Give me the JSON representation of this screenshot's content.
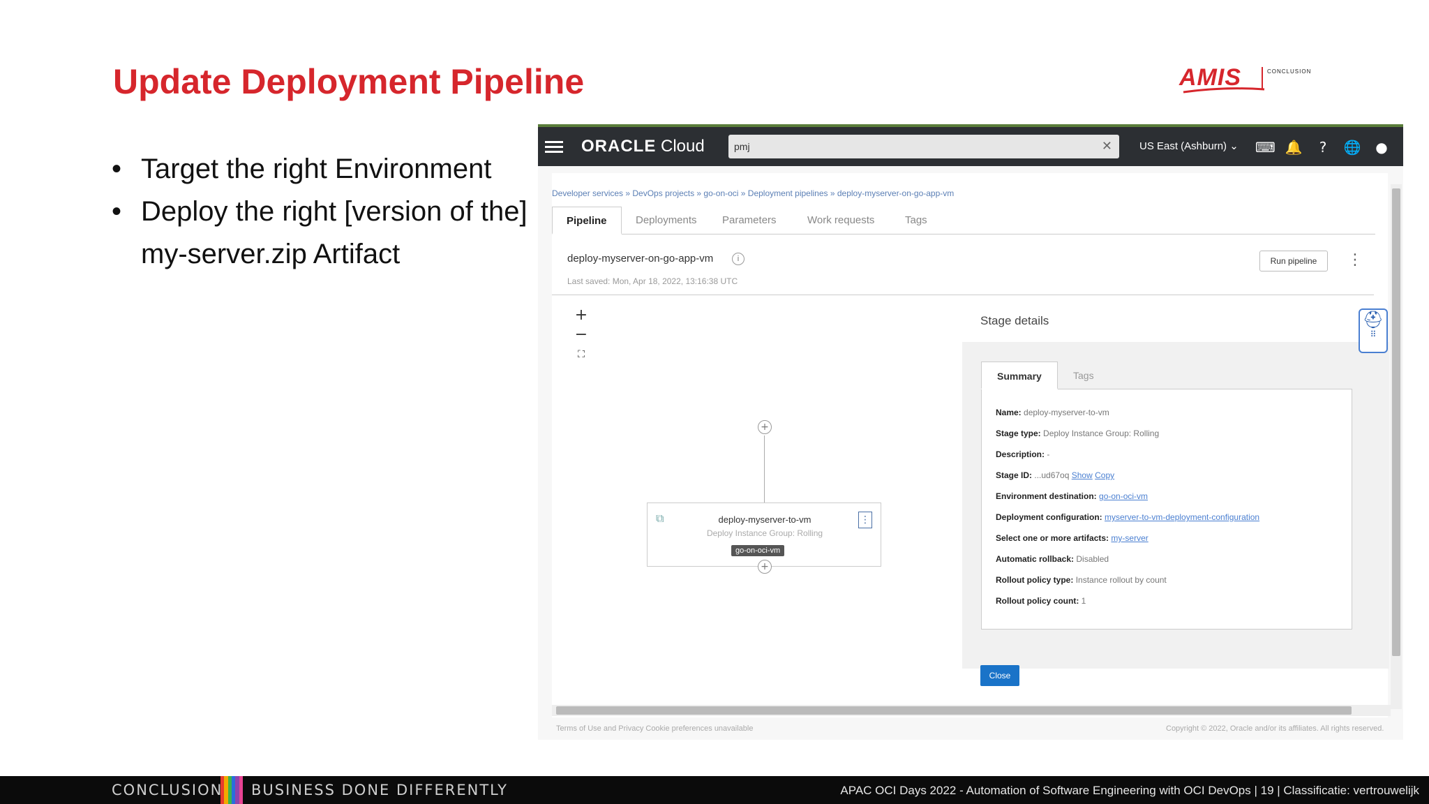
{
  "slide": {
    "title": "Update Deployment Pipeline",
    "bullets": [
      "Target the right Environment",
      "Deploy the right [version of the] my-server.zip Artifact"
    ]
  },
  "logo": {
    "word": "AMIS",
    "sub": "CONCLUSION"
  },
  "oci": {
    "brand_bold": "ORACLE",
    "brand_light": " Cloud",
    "search_value": "pmj",
    "region": "US East (Ashburn) ⌄",
    "breadcrumb": "Developer services » DevOps projects » go-on-oci » Deployment pipelines » deploy-myserver-on-go-app-vm",
    "tabs": [
      "Pipeline",
      "Deployments",
      "Parameters",
      "Work requests",
      "Tags"
    ],
    "pipeline_name": "deploy-myserver-on-go-app-vm",
    "last_saved": "Last saved: Mon, Apr 18, 2022, 13:16:38 UTC",
    "run_pipeline": "Run pipeline",
    "node": {
      "title": "deploy-myserver-to-vm",
      "subtitle": "Deploy Instance Group: Rolling",
      "badge": "go-on-oci-vm"
    },
    "stage": {
      "heading": "Stage details",
      "tabs": [
        "Summary",
        "Tags"
      ],
      "rows": [
        {
          "label": "Name:",
          "value": "deploy-myserver-to-vm"
        },
        {
          "label": "Stage type:",
          "value": "Deploy Instance Group: Rolling"
        },
        {
          "label": "Description:",
          "value": "-"
        },
        {
          "label": "Stage ID:",
          "value": "...ud67oq",
          "links": [
            "Show",
            "Copy"
          ]
        },
        {
          "label": "Environment destination:",
          "link": "go-on-oci-vm"
        },
        {
          "label": "Deployment configuration:",
          "link": "myserver-to-vm-deployment-configuration"
        },
        {
          "label": "Select one or more artifacts:",
          "link": "my-server"
        },
        {
          "label": "Automatic rollback:",
          "value": "Disabled"
        },
        {
          "label": "Rollout policy type:",
          "value": "Instance rollout by count"
        },
        {
          "label": "Rollout policy count:",
          "value": "1"
        }
      ],
      "close": "Close"
    },
    "footer_left": "Terms of Use and Privacy    Cookie preferences unavailable",
    "footer_right": "Copyright © 2022, Oracle and/or its affiliates. All rights reserved."
  },
  "bottom_bar": {
    "left": "CONCLUSION",
    "mid": "BUSINESS DONE DIFFERENTLY",
    "right": "APAC OCI Days 2022 - Automation of Software Engineering with OCI DevOps  |  19 | Classificatie: vertrouwelijk"
  },
  "colors": {
    "accent": "#d6262c",
    "oci_bar": "#2c2f33",
    "link": "#4a7fd1",
    "primary_btn": "#1a73c8"
  },
  "icons": [
    "hamburger-icon",
    "clear-icon",
    "cloud-shell-icon",
    "bell-icon",
    "help-icon",
    "globe-icon",
    "profile-icon",
    "info-icon",
    "kebab-icon",
    "zoom-in-icon",
    "zoom-out-icon",
    "fit-icon",
    "stage-icon",
    "lifebuoy-icon"
  ]
}
